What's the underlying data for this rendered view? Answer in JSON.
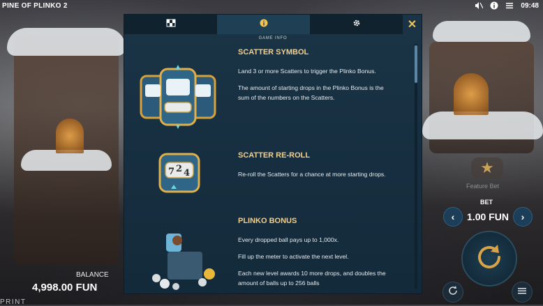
{
  "top_bar": {
    "title": "PINE OF PLINKO 2",
    "time": "09:48",
    "icons": [
      "sound-off-icon",
      "info-icon",
      "menu-icon"
    ]
  },
  "modal": {
    "tabs": [
      {
        "icon": "paytable-icon",
        "active": false
      },
      {
        "icon": "info-icon",
        "active": true
      },
      {
        "icon": "settings-icon",
        "active": false
      }
    ],
    "close_label": "✕",
    "section_heading": "GAME INFO",
    "features": [
      {
        "title": "SCATTER SYMBOL",
        "paragraphs": [
          "Land 3 or more Scatters to trigger the Plinko Bonus.",
          "The amount of starting drops in the Plinko Bonus is the sum of the numbers on the Scatters."
        ]
      },
      {
        "title": "SCATTER RE-ROLL",
        "paragraphs": [
          "Re-roll the Scatters for a chance at more starting drops."
        ]
      },
      {
        "title": "PLINKO BONUS",
        "paragraphs": [
          "Every dropped ball pays up to 1,000x.",
          "Fill up the meter to activate the next level.",
          "Each new level awards 10 more drops, and doubles the amount of balls up to 256 balls"
        ]
      }
    ],
    "reroll_numbers": [
      "7",
      "2",
      "4"
    ]
  },
  "left_panel": {
    "balance_label": "BALANCE",
    "balance_value": "4,998.00 FUN",
    "print_text": "PRINT"
  },
  "right_panel": {
    "feature_bet_label": "Feature Bet",
    "bet_label": "BET",
    "bet_value": "1.00 FUN",
    "decrease_label": "‹",
    "increase_label": "›"
  },
  "colors": {
    "accent_gold": "#f5d08a",
    "modal_bg": "#163040",
    "close_yellow": "#f2c14e"
  }
}
